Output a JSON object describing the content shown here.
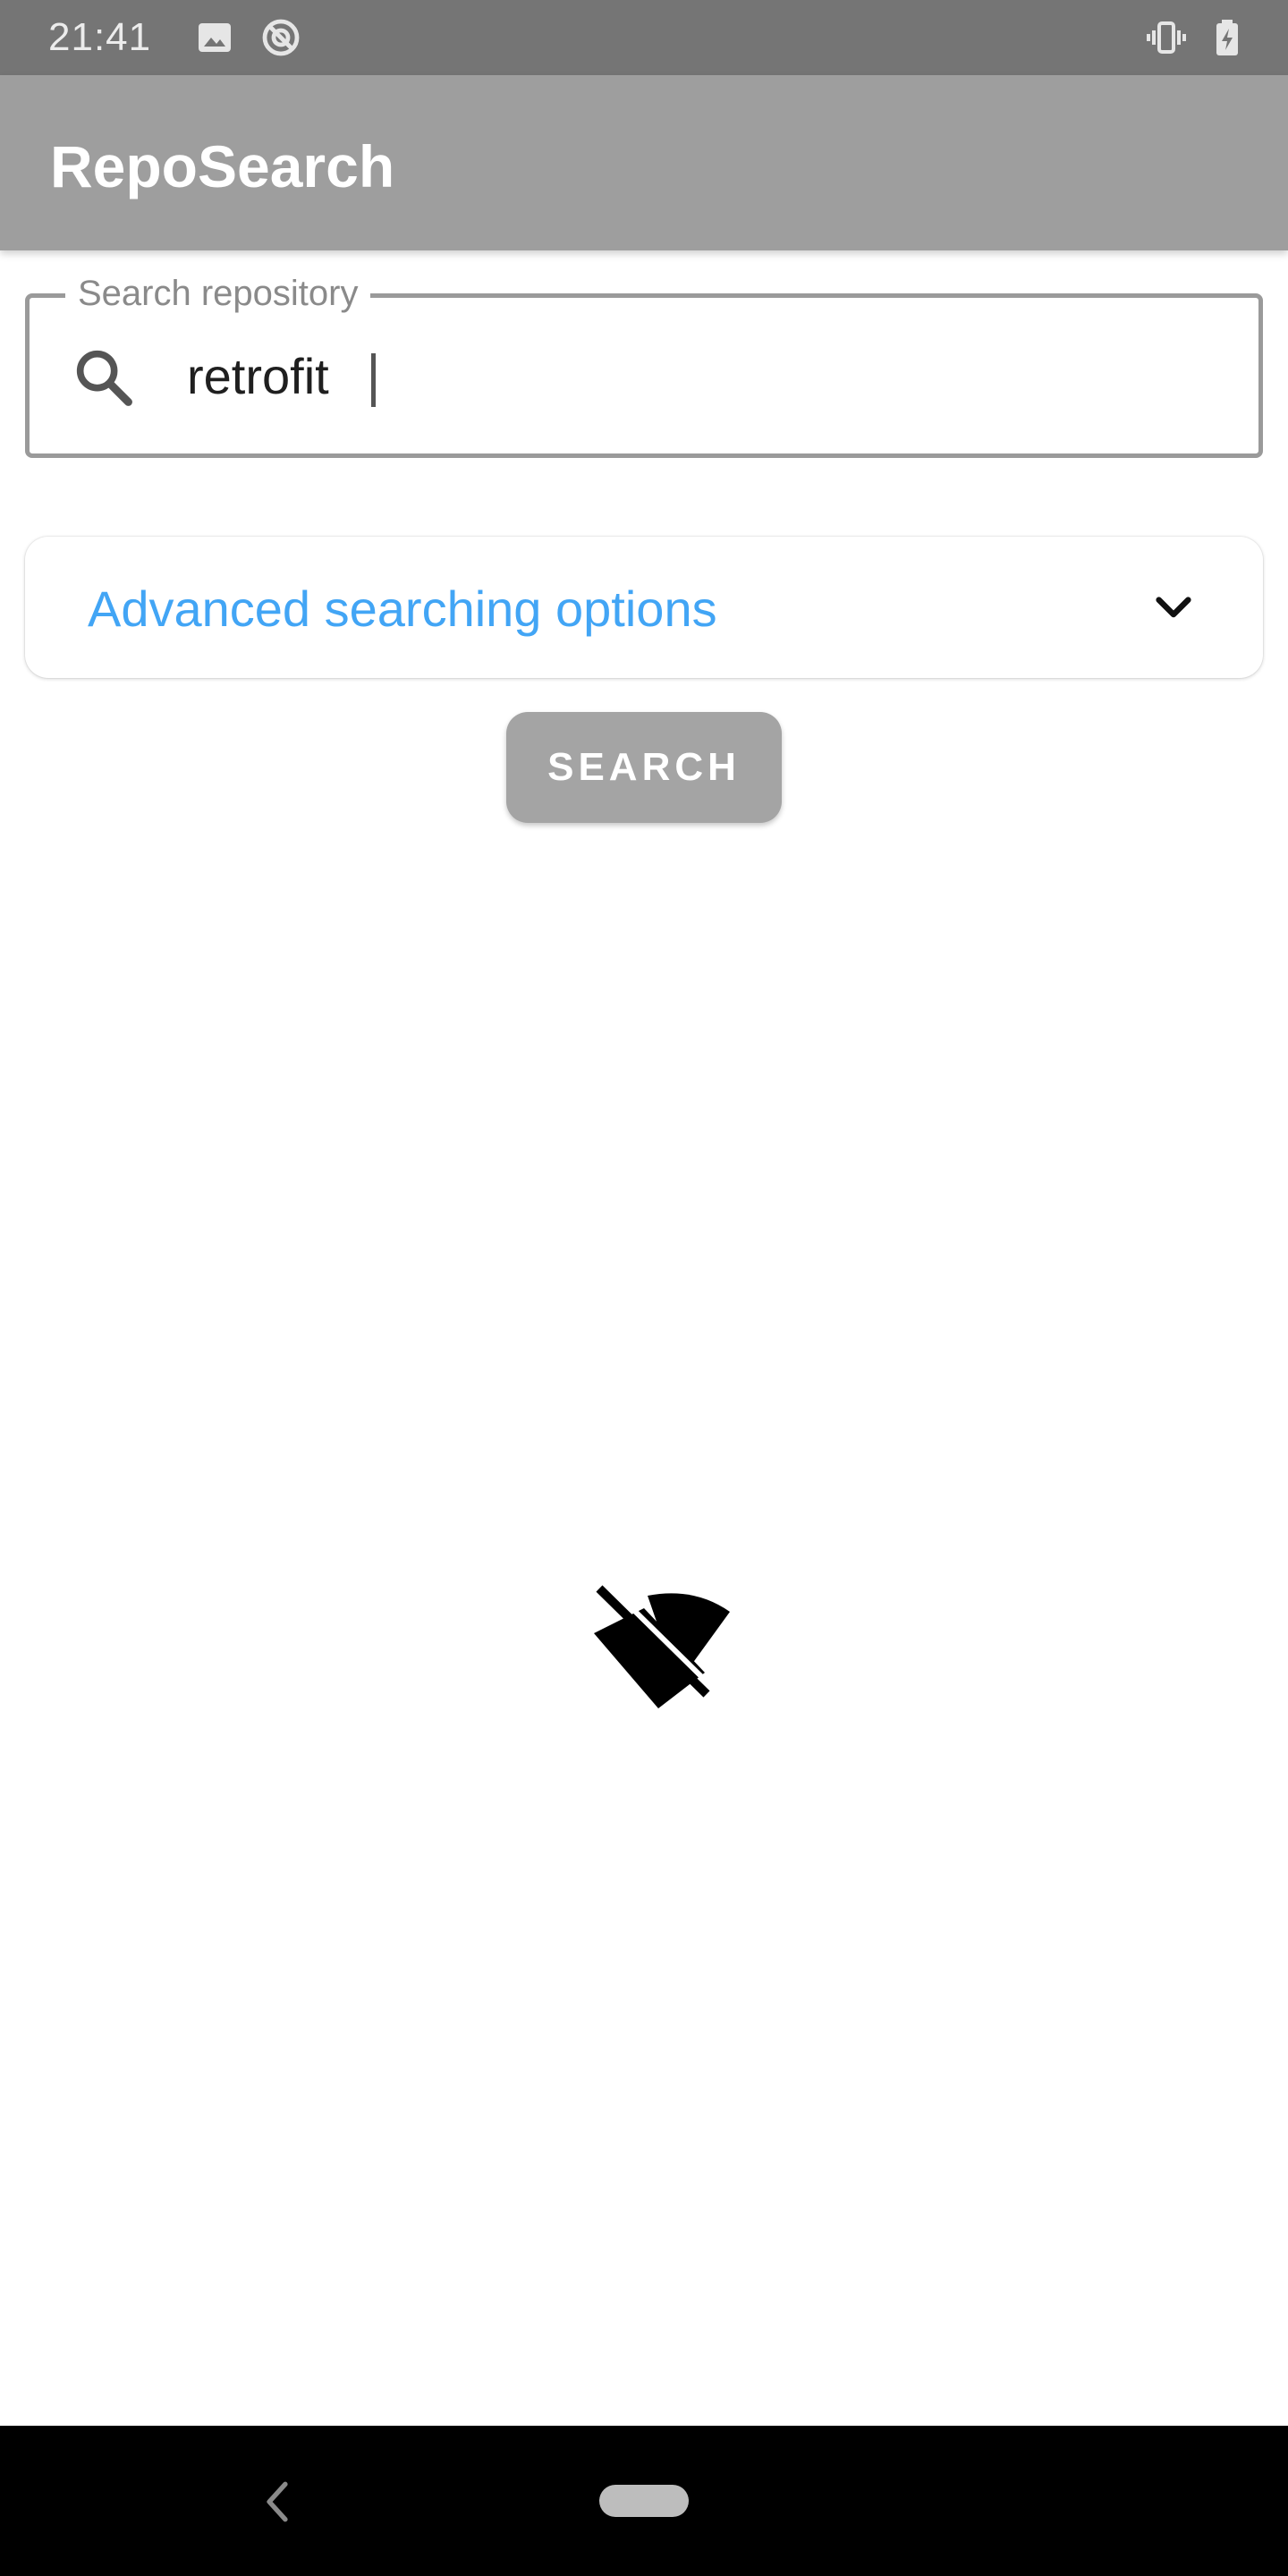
{
  "status_bar": {
    "time": "21:41",
    "icons": [
      "image-icon",
      "sync-disabled-icon",
      "vibrate-icon",
      "battery-charging-icon"
    ]
  },
  "app_bar": {
    "title": "RepoSearch",
    "color": "#9e9e9e"
  },
  "search": {
    "label": "Search repository",
    "value": "retrofit",
    "icon": "search-icon"
  },
  "advanced": {
    "label": "Advanced searching options",
    "color": "#42a5f5",
    "icon": "chevron-down-icon"
  },
  "search_button": {
    "label": "SEARCH"
  },
  "empty_state": {
    "icon": "wifi-off-icon"
  },
  "nav_bar": {
    "icons": [
      "back-icon",
      "home-pill"
    ]
  }
}
